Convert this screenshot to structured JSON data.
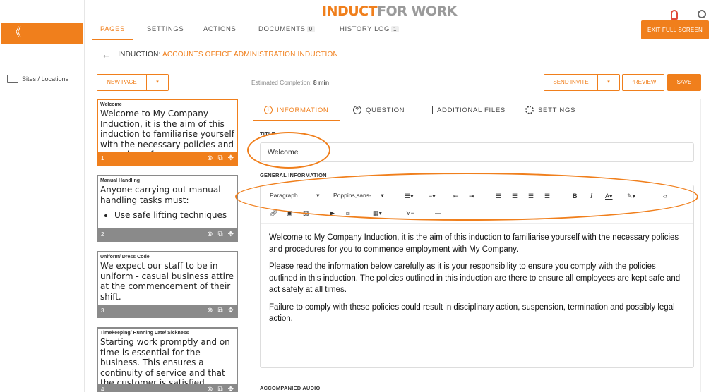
{
  "brand": {
    "part1": "INDUCT",
    "part2": "FOR WORK"
  },
  "sidebar": {
    "collapse_icon": "《",
    "item": "Sites / Locations"
  },
  "tabs": [
    {
      "label": "PAGES"
    },
    {
      "label": "SETTINGS"
    },
    {
      "label": "ACTIONS"
    },
    {
      "label": "DOCUMENTS",
      "count": "0"
    },
    {
      "label": "HISTORY LOG",
      "count": "1"
    }
  ],
  "exit_button": "EXIT FULL SCREEN",
  "breadcrumb": {
    "prefix": "INDUCTION:",
    "name": "ACCOUNTS OFFICE ADMINISTRATION INDUCTION"
  },
  "toolbar": {
    "new_page": "NEW PAGE",
    "estimated_label": "Estimated Completion:",
    "estimated_value": "8 min",
    "send_invite": "SEND INVITE",
    "preview": "PREVIEW",
    "save": "SAVE"
  },
  "pages": [
    {
      "title": "Welcome",
      "body": "Welcome to My Company Induction, it is the aim of this induction to familiarise yourself with the necessary policies and procedures for you",
      "number": "1"
    },
    {
      "title": "Manual Handling",
      "body": "Anyone carrying out manual handling tasks must:",
      "bullet": "Use safe lifting techniques",
      "number": "2"
    },
    {
      "title": "Uniform/ Dress Code",
      "body": "We expect our staff to be in uniform - casual business attire at the commencement of their shift.",
      "number": "3"
    },
    {
      "title": "Timekeeping/ Running Late/ Sickness",
      "body": "Starting work promptly and on time is essential for the business. This ensures a continuity of service and that the customer is satisfied",
      "number": "4"
    }
  ],
  "inner_tabs": [
    {
      "label": "INFORMATION"
    },
    {
      "label": "QUESTION"
    },
    {
      "label": "ADDITIONAL FILES"
    },
    {
      "label": "SETTINGS"
    }
  ],
  "form": {
    "title_label": "TITLE",
    "title_value": "Welcome",
    "general_label": "GENERAL INFORMATION",
    "audio_label": "ACCOMPANIED AUDIO"
  },
  "editor": {
    "format": "Paragraph",
    "font": "Poppins,sans-...",
    "paragraphs": [
      "Welcome to My Company Induction, it is the aim of this induction to familiarise yourself with the necessary policies and procedures for you to commence employment with My Company.",
      "Please read the information below carefully as it is your responsibility to ensure you comply with the policies outlined in this induction. The policies outlined in this induction are there to ensure all employees are kept safe and act safely at all times.",
      "Failure to comply with these policies could result in disciplinary action, suspension, termination and possibly legal action."
    ]
  },
  "colors": {
    "accent": "#f07f1c",
    "card_border": "#8a8a8a"
  }
}
